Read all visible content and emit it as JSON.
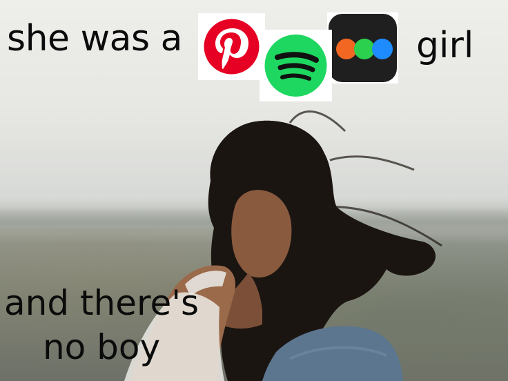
{
  "meme": {
    "top_caption": "she was a",
    "top_caption_end": "girl",
    "bottom_caption_line1": "and there's",
    "bottom_caption_line2": "no boy"
  },
  "logos": [
    {
      "icon": "pinterest-icon",
      "color": "#e60023"
    },
    {
      "icon": "spotify-icon",
      "color": "#1ed760"
    },
    {
      "icon": "multi-dot-app-icon",
      "colors": [
        "#f26722",
        "#2bd04e",
        "#1e8bff"
      ],
      "background": "#1f1f1f"
    }
  ]
}
